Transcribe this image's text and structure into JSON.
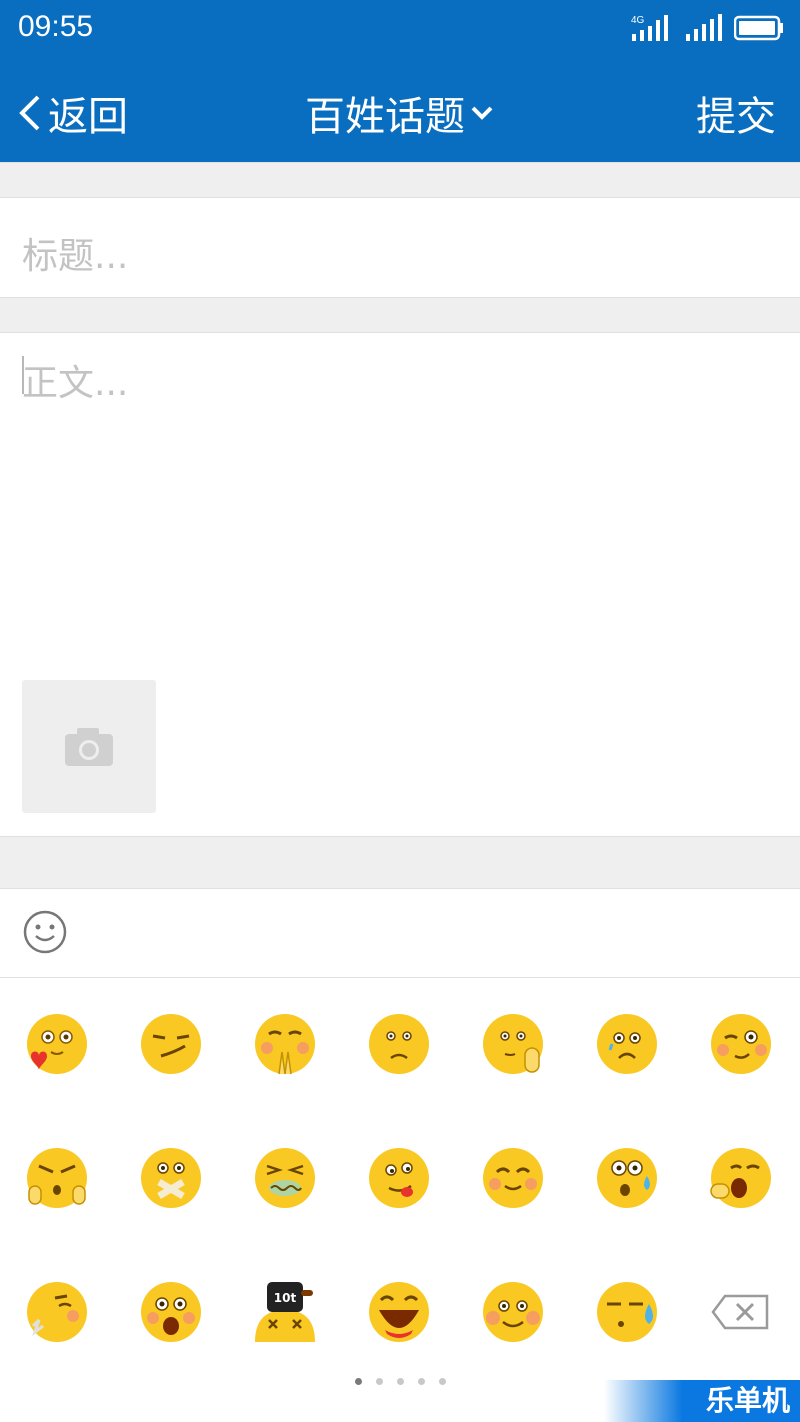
{
  "status_bar": {
    "time": "09:55",
    "network": "4G"
  },
  "nav": {
    "back_label": "返回",
    "title": "百姓话题",
    "submit_label": "提交"
  },
  "form": {
    "title_placeholder": "标题...",
    "body_placeholder": "正文..."
  },
  "emoji_panel": {
    "rows": [
      [
        "heart-eyes-face",
        "smirk-face",
        "pray-face",
        "puzzled-face",
        "thinking-face",
        "sad-face",
        "wink-face"
      ],
      [
        "angry-face",
        "sealed-mouth-face",
        "dizzy-face",
        "tongue-out-face",
        "smile-face",
        "sweat-surprised-face",
        "yawn-face"
      ],
      [
        "kiss-face",
        "shocked-face",
        "knocked-out-face",
        "laughing-face",
        "blush-face",
        "sweat-face",
        "backspace-key"
      ]
    ],
    "page_count": 5,
    "active_page": 1
  },
  "watermark": {
    "text": "乐单机"
  },
  "colors": {
    "header": "#0a6ec0",
    "emoji_yellow": "#f9c823",
    "separator": "#efefef"
  }
}
